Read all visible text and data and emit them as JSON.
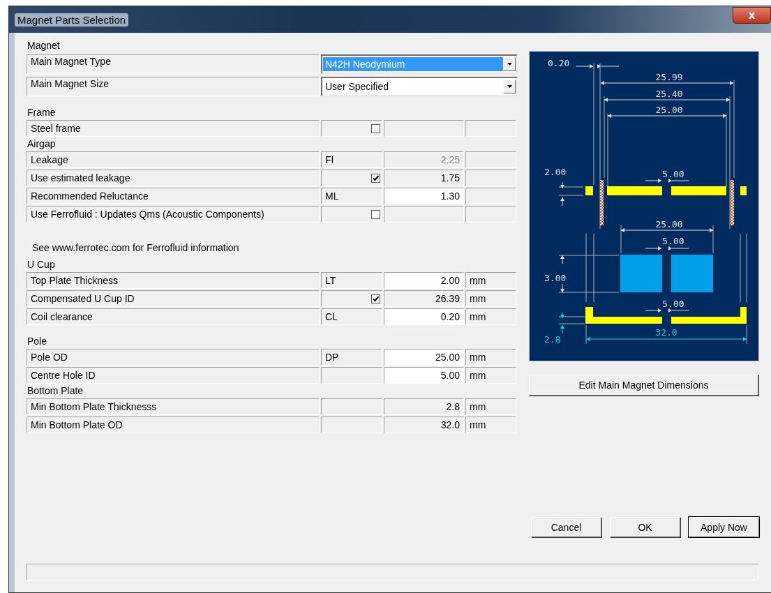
{
  "window": {
    "title": "Magnet Parts Selection",
    "close": "x"
  },
  "sections": [
    {
      "title": "Magnet",
      "rows": [
        {
          "kind": "combo",
          "label": "Main Magnet Type",
          "value": "N42H Neodymium",
          "selected": true
        },
        {
          "kind": "combo",
          "label": "Main Magnet Size",
          "value": "User Specified",
          "selected": false
        }
      ]
    },
    {
      "title": "Frame",
      "rows": [
        {
          "kind": "check",
          "label": "Steel frame",
          "checked": false
        }
      ]
    },
    {
      "title": "Airgap",
      "rows": [
        {
          "kind": "grid",
          "label": "Leakage",
          "code": "FI",
          "value": "2.25",
          "editable": false,
          "disabled": true
        },
        {
          "kind": "check",
          "label": "Use estimated leakage",
          "checked": true,
          "value": "1.75",
          "editable": false,
          "disabled": false
        },
        {
          "kind": "grid",
          "label": "Recommended Reluctance",
          "code": "ML",
          "value": "1.30",
          "editable": true,
          "disabled": false
        },
        {
          "kind": "check",
          "label": "Use Ferrofluid : Updates Qms (Acoustic Components)",
          "checked": false
        }
      ]
    },
    {
      "note": "See www.ferrotec.com for Ferrofluid information",
      "title": "U Cup",
      "rows": [
        {
          "kind": "grid",
          "label": "Top Plate Thickness",
          "code": "LT",
          "value": "2.00",
          "editable": true,
          "disabled": false,
          "unit": "mm"
        },
        {
          "kind": "check",
          "label": "Compensated U Cup ID",
          "checked": true,
          "value": "26.39",
          "editable": false,
          "disabled": false,
          "unit": "mm"
        },
        {
          "kind": "grid",
          "label": "Coil clearance",
          "code": "CL",
          "value": "0.20",
          "editable": true,
          "disabled": false,
          "unit": "mm"
        }
      ]
    },
    {
      "title": "Pole",
      "rows": [
        {
          "kind": "grid",
          "label": "Pole OD",
          "code": "DP",
          "value": "25.00",
          "editable": true,
          "disabled": false,
          "unit": "mm"
        },
        {
          "kind": "grid",
          "label": "Centre Hole ID",
          "value": "5.00",
          "editable": true,
          "disabled": false,
          "unit": "mm"
        }
      ]
    },
    {
      "title": "Bottom Plate",
      "rows": [
        {
          "kind": "grid",
          "label": "Min Bottom Plate Thicknesss",
          "value": "2.8",
          "editable": false,
          "disabled": false,
          "unit": "mm"
        },
        {
          "kind": "grid",
          "label": "Min Bottom Plate OD",
          "value": "32.0",
          "editable": false,
          "disabled": false,
          "unit": "mm"
        }
      ]
    }
  ],
  "diagram": {
    "labels": [
      {
        "text": "0.20",
        "color": "#e0e0e0"
      },
      {
        "text": "25.99",
        "color": "#e0e0e0"
      },
      {
        "text": "25.40",
        "color": "#e0e0e0"
      },
      {
        "text": "25.00",
        "color": "#e0e0e0"
      },
      {
        "text": "2.00",
        "color": "#e0e0e0"
      },
      {
        "text": "5.00",
        "color": "#e0e0e0"
      },
      {
        "text": "25.00",
        "color": "#e0e0e0"
      },
      {
        "text": "5.00",
        "color": "#e0e0e0"
      },
      {
        "text": "3.00",
        "color": "#e0e0e0"
      },
      {
        "text": "5.00",
        "color": "#e0e0e0"
      },
      {
        "text": "32.0",
        "color": "#1ad0e0"
      },
      {
        "text": "2.8",
        "color": "#1ad0e0"
      }
    ]
  },
  "edit_button": "Edit Main Magnet Dimensions",
  "buttons": [
    {
      "label": "Cancel",
      "default": false
    },
    {
      "label": "OK",
      "default": false
    },
    {
      "label": "Apply Now",
      "default": true
    }
  ]
}
